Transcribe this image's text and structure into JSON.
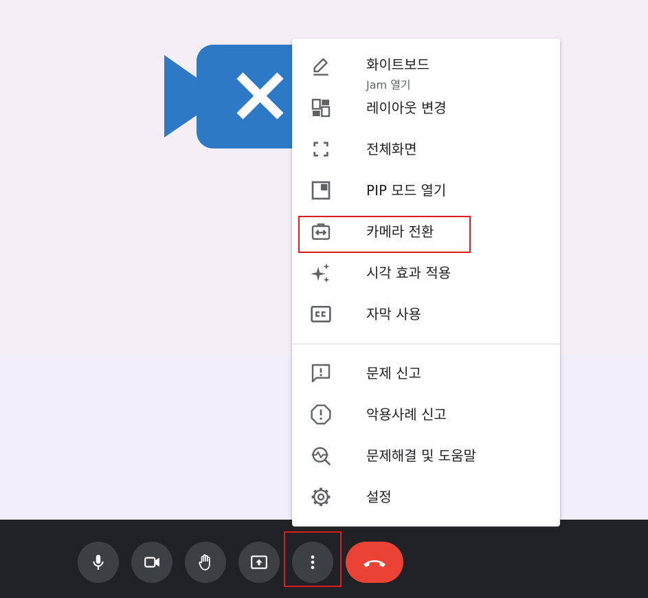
{
  "colors": {
    "accent_blue": "#2e79c6",
    "end_call_red": "#ea4335",
    "highlight_red": "#e01b1b",
    "control_bar": "#202124",
    "control_button": "#3c4043"
  },
  "stage": {
    "icon": "video-off-icon"
  },
  "menu": {
    "items": [
      {
        "label": "화이트보드",
        "sub": "Jam 열기",
        "icon": "pencil-icon"
      },
      {
        "label": "레이아웃 변경",
        "icon": "layout-icon"
      },
      {
        "label": "전체화면",
        "icon": "fullscreen-icon"
      },
      {
        "label": "PIP 모드 열기",
        "icon": "picture-in-picture-icon"
      },
      {
        "label": "카메라 전환",
        "icon": "switch-camera-icon"
      },
      {
        "label": "시각 효과 적용",
        "icon": "sparkle-icon"
      },
      {
        "label": "자막 사용",
        "icon": "closed-captions-icon"
      },
      {
        "label": "문제 신고",
        "icon": "feedback-icon"
      },
      {
        "label": "악용사례 신고",
        "icon": "report-icon"
      },
      {
        "label": "문제해결 및 도움말",
        "icon": "troubleshoot-icon"
      },
      {
        "label": "설정",
        "icon": "settings-gear-icon"
      }
    ]
  },
  "controls": [
    {
      "icon": "microphone-icon"
    },
    {
      "icon": "camera-icon"
    },
    {
      "icon": "raise-hand-icon"
    },
    {
      "icon": "present-screen-icon"
    },
    {
      "icon": "more-options-icon"
    },
    {
      "icon": "end-call-icon"
    }
  ]
}
